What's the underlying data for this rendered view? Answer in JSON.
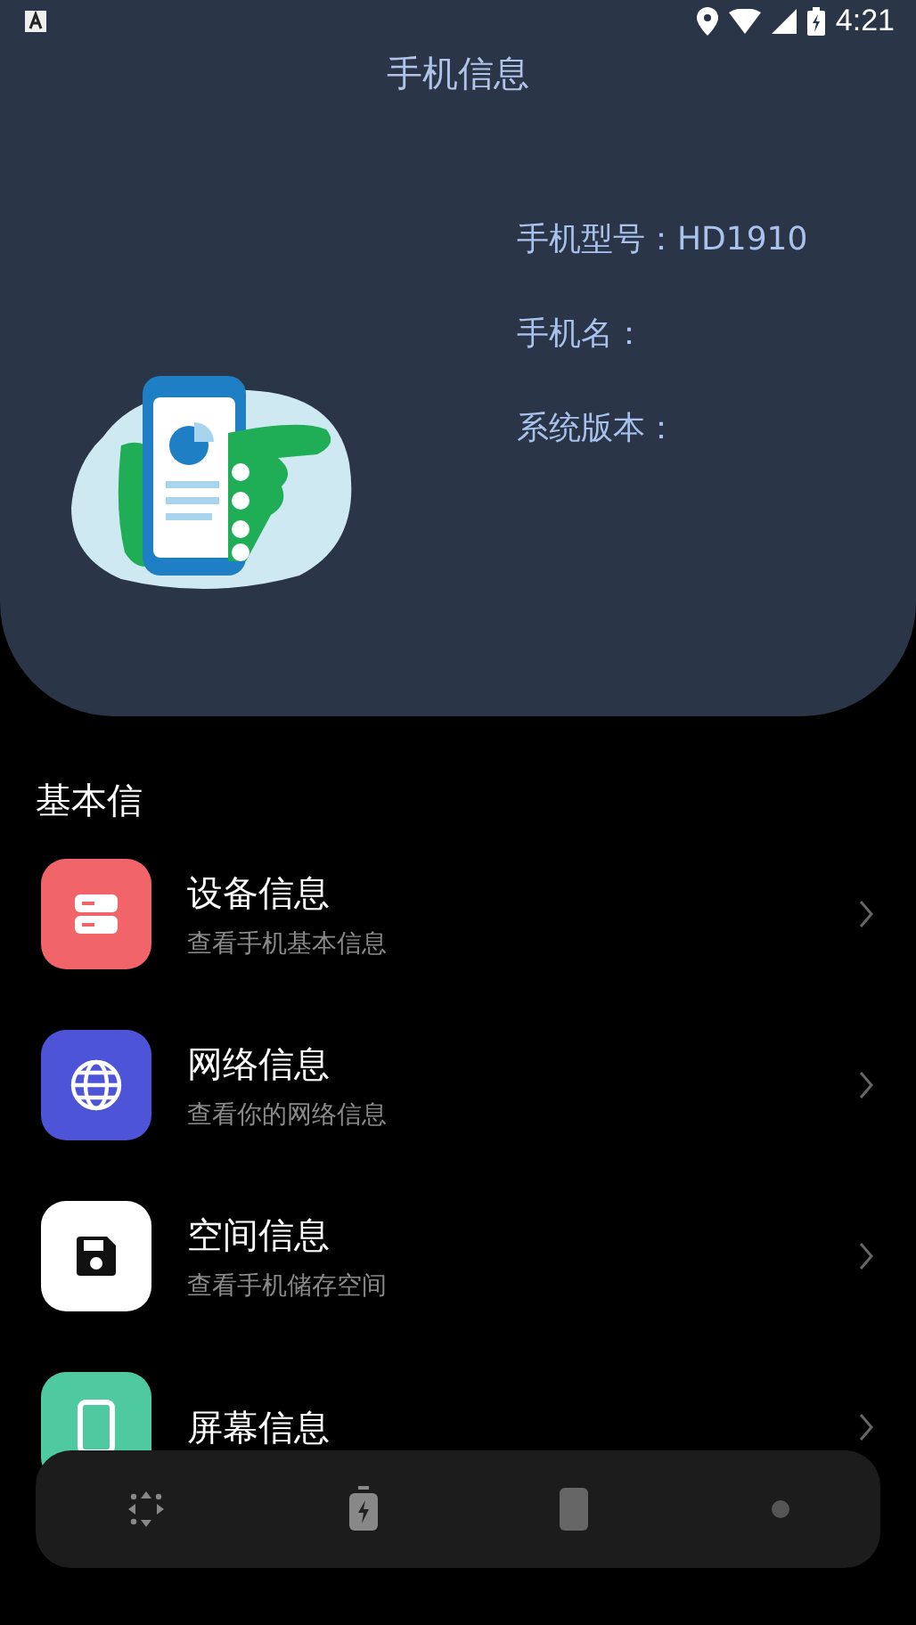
{
  "status_bar": {
    "time": "4:21"
  },
  "header": {
    "title": "手机信息",
    "info": [
      {
        "label": "手机型号：",
        "value": "HD1910"
      },
      {
        "label": "手机名："
      },
      {
        "label": "系统版本："
      }
    ]
  },
  "section": {
    "title": "基本信"
  },
  "items": [
    {
      "kind": "device",
      "title": "设备信息",
      "subtitle": "查看手机基本信息",
      "color": "#f0646a"
    },
    {
      "kind": "network",
      "title": "网络信息",
      "subtitle": "查看你的网络信息",
      "color": "#4e54d8"
    },
    {
      "kind": "storage",
      "title": "空间信息",
      "subtitle": "查看手机储存空间",
      "color": "#ffffff"
    },
    {
      "kind": "screen",
      "title": "屏幕信息",
      "color": "#4fc9a0"
    }
  ],
  "bottom_nav": [
    {
      "kind": "dpad"
    },
    {
      "kind": "battery"
    },
    {
      "kind": "phone"
    },
    {
      "kind": "dot"
    }
  ]
}
